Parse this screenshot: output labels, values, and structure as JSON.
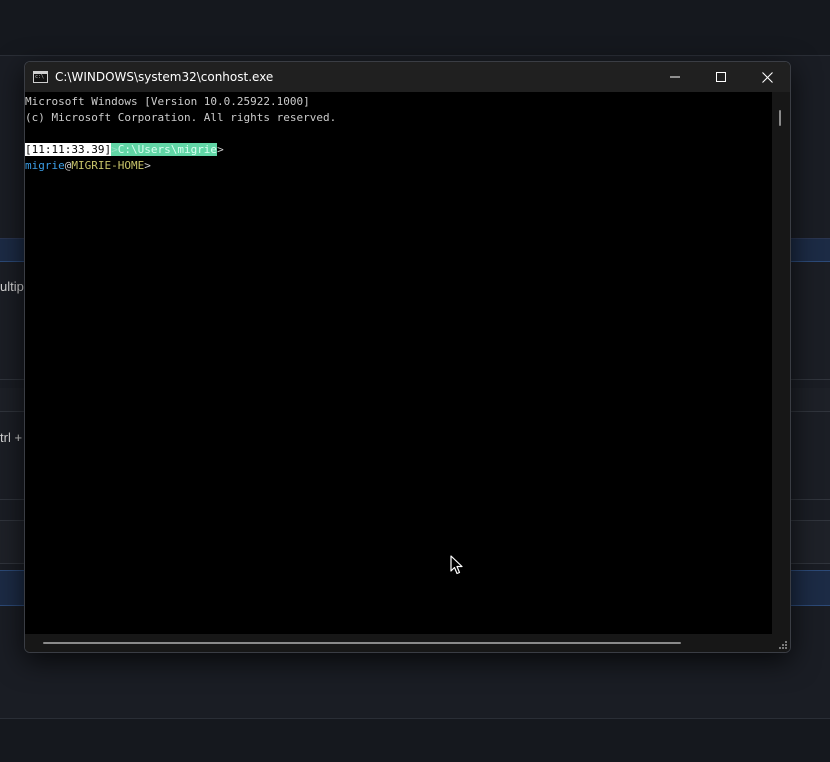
{
  "background": {
    "partial_text_1": "ultip",
    "partial_text_2": "trl +"
  },
  "window": {
    "title": "C:\\WINDOWS\\system32\\conhost.exe",
    "icon": "console-app-icon",
    "controls": [
      "minimize-icon",
      "maximize-icon",
      "close-icon"
    ]
  },
  "console": {
    "line1": "Microsoft Windows [Version 10.0.25922.1000]",
    "line2": "(c) Microsoft Corporation. All rights reserved.",
    "prompt": {
      "timestamp": "[11:11:33.39]",
      "path_lead": ">",
      "path": "C:\\Users\\migrie",
      "path_tail": ">",
      "user": "migrie",
      "at": "@",
      "host": "MIGRIE-HOME",
      "end": ">"
    }
  },
  "colors": {
    "timestamp_bg": "#ffffff",
    "path_bg": "#61d6a6",
    "user": "#3b9ee6",
    "host": "#c9c56a"
  }
}
